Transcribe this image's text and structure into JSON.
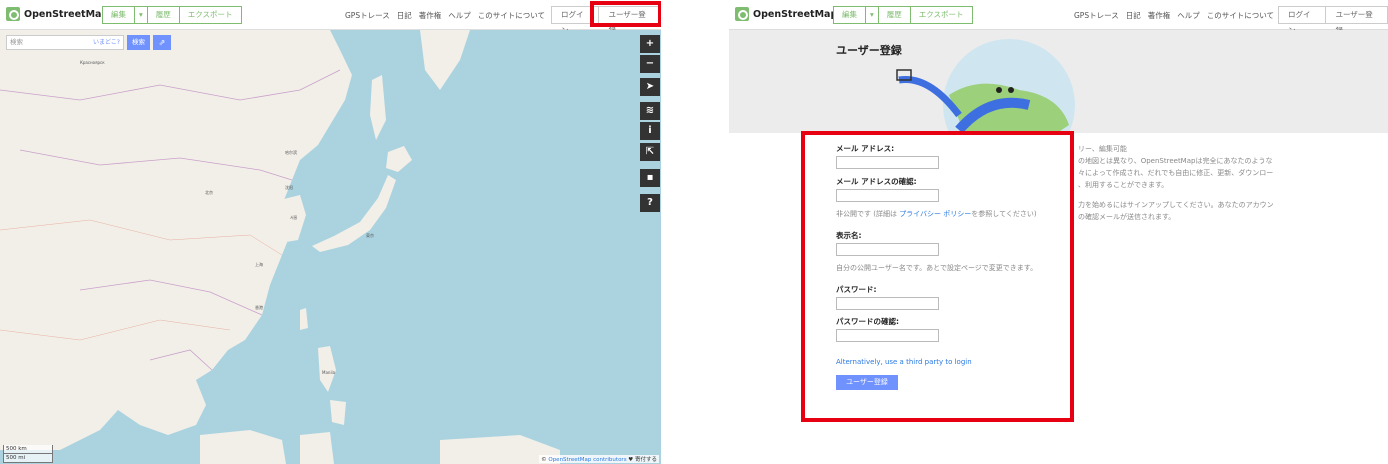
{
  "header": {
    "logo_text": "OpenStreetMap",
    "edit_label": "編集",
    "edit_caret": "▾",
    "history_label": "履歴",
    "export_label": "エクスポート",
    "nav": [
      "GPSトレース",
      "日記",
      "著作権",
      "ヘルプ",
      "このサイトについて"
    ],
    "login_label": "ログイン",
    "signup_label": "ユーザー登録"
  },
  "map_view": {
    "search_placeholder": "検索",
    "where_am_i": "いまどこ?",
    "search_button": "検索",
    "directions_icon": "directions-icon",
    "controls": [
      "zoom-in-icon",
      "zoom-out-icon",
      "locate-icon",
      "layers-icon",
      "info-icon",
      "share-icon",
      "note-icon",
      "query-icon"
    ],
    "control_glyphs": [
      "+",
      "−",
      "➤",
      "≋",
      "i",
      "⇱",
      "▪",
      "?"
    ],
    "scale_km": "500 km",
    "scale_mi": "500 mi",
    "attribution_prefix": "© ",
    "attribution_link": "OpenStreetMap contributors",
    "attribution_suffix": " ♥ 寄付する",
    "colors": {
      "sea": "#aad3df",
      "land": "#f2efe9",
      "accent": "#7092ff"
    }
  },
  "signup": {
    "title": "ユーザー登録",
    "email_label": "メール アドレス:",
    "email_confirm_label": "メール アドレスの確認:",
    "privacy_hint_prefix": "非公開です (詳細は ",
    "privacy_link": "プライバシー ポリシー",
    "privacy_hint_suffix": "を参照してください)",
    "display_name_label": "表示名:",
    "display_name_hint": "自分の公開ユーザー名です。あとで設定ページで変更できます。",
    "password_label": "パスワード:",
    "password_confirm_label": "パスワードの確認:",
    "third_party_link": "Alternatively, use a third party to login",
    "submit_label": "ユーザー登録",
    "description": [
      "リー、編集可能",
      "の地図とは異なり、OpenStreetMapは完全にあなたのような",
      "々によって作成され、だれでも自由に修正、更新、ダウンロー",
      "、利用することができます。",
      "力を始めるにはサインアップしてください。あなたのアカウン",
      "の確認メールが送信されます。"
    ]
  }
}
